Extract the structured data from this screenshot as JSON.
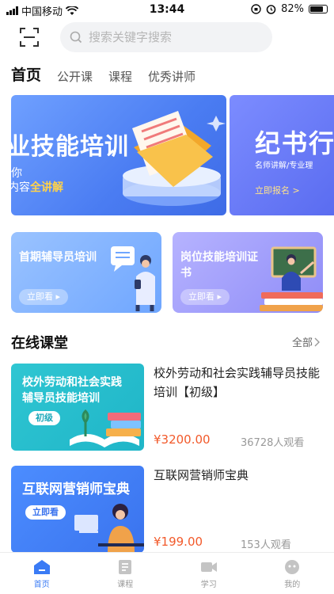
{
  "status_bar": {
    "carrier": "中国移动",
    "time": "13:44",
    "battery_percent": "82%",
    "battery_level": 0.82
  },
  "search": {
    "placeholder": "搜索关键字搜索"
  },
  "tabs": [
    {
      "label": "首页",
      "active": true
    },
    {
      "label": "公开课",
      "active": false
    },
    {
      "label": "课程",
      "active": false
    },
    {
      "label": "优秀讲师",
      "active": false
    }
  ],
  "banners": {
    "first": {
      "title": "业技能培训",
      "line1": "你",
      "line2_prefix": "内容",
      "line2_highlight": "全讲解"
    },
    "second": {
      "title": "纪书行",
      "subtitle": "名师讲解/专业理",
      "cta": "立即报名 >"
    }
  },
  "cards": [
    {
      "title": "首期辅导员培训",
      "button": "立即看 ▸"
    },
    {
      "title": "岗位技能培训证书",
      "button": "立即看 ▸"
    }
  ],
  "section": {
    "title": "在线课堂",
    "all_label": "全部"
  },
  "courses": [
    {
      "thumb_title_line1": "校外劳动和社会实践",
      "thumb_title_line2": "辅导员技能培训",
      "thumb_tag": "初级",
      "title": "校外劳动和社会实践辅导员技能培训【初级】",
      "price": "¥3200.00",
      "views": "36728人观看"
    },
    {
      "thumb_title_line1": "互联网营销师宝典",
      "thumb_tag": "立即看",
      "title": "互联网营销师宝典",
      "price": "¥199.00",
      "views": "153人观看"
    }
  ],
  "bottom_nav": [
    {
      "label": "首页",
      "icon": "home-icon",
      "active": true
    },
    {
      "label": "课程",
      "icon": "course-icon",
      "active": false
    },
    {
      "label": "学习",
      "icon": "video-icon",
      "active": false
    },
    {
      "label": "我的",
      "icon": "profile-icon",
      "active": false
    }
  ],
  "colors": {
    "accent": "#3a7bf5",
    "price": "#f25a2b",
    "banner_highlight": "#ffd24a"
  }
}
